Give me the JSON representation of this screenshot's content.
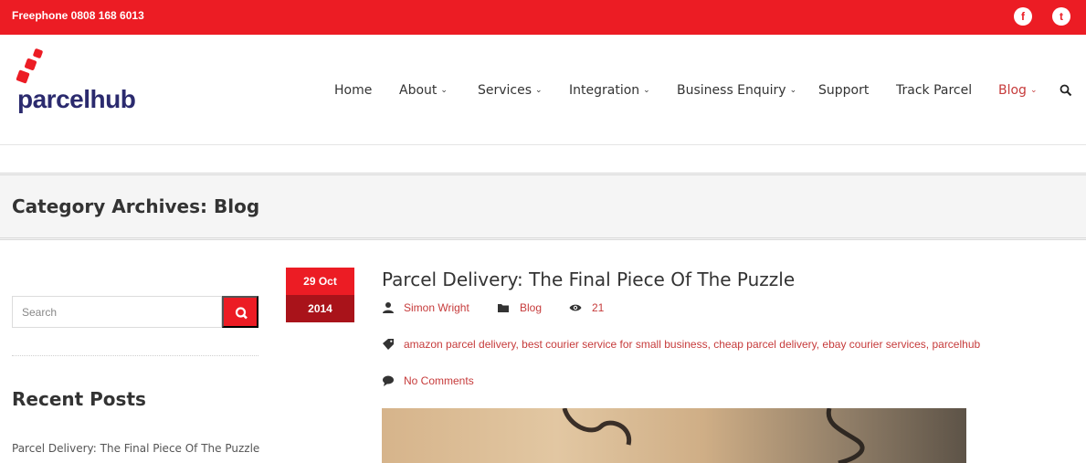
{
  "topbar": {
    "phone": "Freephone 0808 168 6013",
    "social": [
      {
        "icon": "facebook-icon",
        "glyph": "f"
      },
      {
        "icon": "twitter-icon",
        "glyph": "t"
      }
    ]
  },
  "brand": {
    "logo_text": "parcelhub"
  },
  "nav": {
    "items": [
      {
        "label": "Home",
        "dropdown": false
      },
      {
        "label": "About",
        "dropdown": true
      },
      {
        "label": "Services",
        "dropdown": true
      },
      {
        "label": "Integration",
        "dropdown": true
      },
      {
        "label": "Business Enquiry",
        "dropdown": true
      },
      {
        "label": "Support",
        "dropdown": false
      },
      {
        "label": "Track Parcel",
        "dropdown": false
      },
      {
        "label": "Blog",
        "dropdown": true,
        "active": true
      }
    ],
    "chevron": "⌄"
  },
  "page": {
    "title": "Category Archives: Blog"
  },
  "sidebar": {
    "search_placeholder": "Search",
    "recent_title": "Recent Posts",
    "recent_posts": [
      "Parcel Delivery: The Final Piece Of The Puzzle"
    ]
  },
  "post": {
    "date_day": "29 Oct",
    "date_year": "2014",
    "title": "Parcel Delivery: The Final Piece Of The Puzzle",
    "author": "Simon Wright",
    "category": "Blog",
    "views": "21",
    "tags": "amazon parcel delivery, best courier service for small business, cheap parcel delivery, ebay courier services, parcelhub",
    "comments": "No Comments"
  },
  "colors": {
    "brand_red": "#ec1c24",
    "dark_red": "#a9131a",
    "link_red": "#c63b3b",
    "logo_navy": "#2b2a6e"
  }
}
